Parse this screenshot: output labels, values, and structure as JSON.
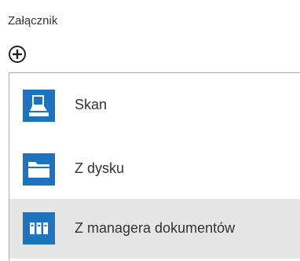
{
  "attachment": {
    "label": "Załącznik",
    "add_icon": "plus-circle-icon"
  },
  "menu": {
    "items": [
      {
        "label": "Skan",
        "icon": "scanner-icon"
      },
      {
        "label": "Z dysku",
        "icon": "folder-icon"
      },
      {
        "label": "Z managera dokumentów",
        "icon": "document-binders-icon"
      }
    ],
    "highlighted_index": 2
  },
  "colors": {
    "icon_background": "#1e73be",
    "highlight_background": "#e6e6e6",
    "text": "#333333"
  }
}
